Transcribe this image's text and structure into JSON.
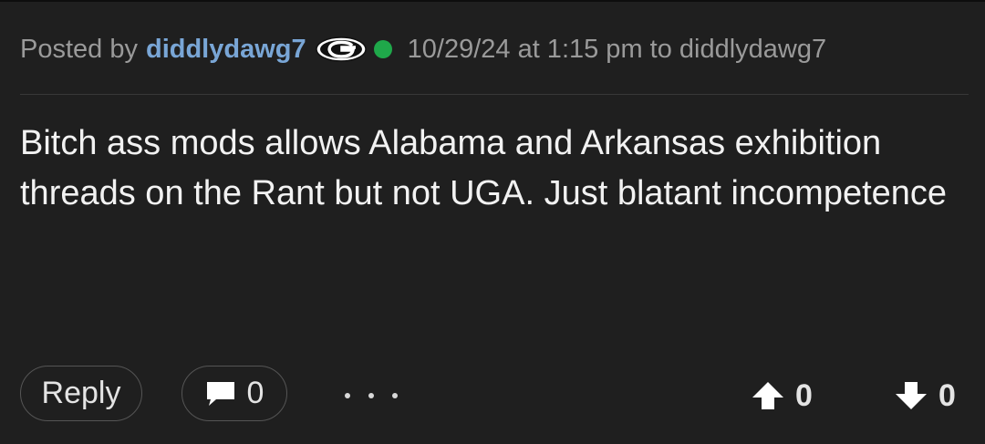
{
  "post": {
    "posted_by_prefix": "Posted by",
    "username": "diddlydawg7",
    "team_logo_letter": "G",
    "timestamp_text": "10/29/24 at 1:15 pm to diddlydawg7",
    "body": "Bitch ass mods allows Alabama and Arkansas exhibition threads on the Rant but not UGA. Just blatant incompetence"
  },
  "actions": {
    "reply_label": "Reply",
    "comment_count": "0",
    "upvote_count": "0",
    "downvote_count": "0"
  },
  "icons": {
    "team_logo": "georgia-g-icon",
    "online_status": "online-dot-icon",
    "comment": "comment-bubble-icon",
    "more": "more-dots-icon",
    "upvote": "arrow-up-icon",
    "downvote": "arrow-down-icon"
  },
  "colors": {
    "background": "#1f1f1f",
    "username": "#79a6d6",
    "meta_text": "#9a9a9a",
    "body_text": "#f2f2f2",
    "online": "#1fa84a"
  }
}
